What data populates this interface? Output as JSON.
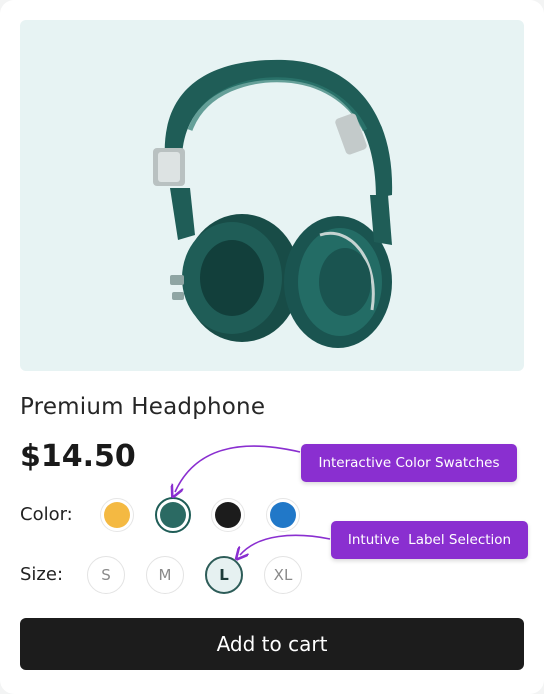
{
  "product": {
    "name": "Premium Headphone",
    "price": "$14.50",
    "image_icon": "headphones-image"
  },
  "color": {
    "label": "Color:",
    "options": [
      {
        "name": "yellow",
        "hex": "#f4b942",
        "selected": false
      },
      {
        "name": "green",
        "hex": "#2b6a63",
        "selected": true
      },
      {
        "name": "black",
        "hex": "#1c1c1c",
        "selected": false
      },
      {
        "name": "blue",
        "hex": "#2178c8",
        "selected": false
      }
    ]
  },
  "size": {
    "label": "Size:",
    "options": [
      {
        "label": "S",
        "selected": false
      },
      {
        "label": "M",
        "selected": false
      },
      {
        "label": "L",
        "selected": true
      },
      {
        "label": "XL",
        "selected": false
      }
    ]
  },
  "annotations": {
    "color_swatches": "Interactive Color Swatches",
    "label_selection": "Intutive  Label Selection",
    "accent": "#8a2fd0"
  },
  "cart": {
    "label": "Add to cart"
  }
}
